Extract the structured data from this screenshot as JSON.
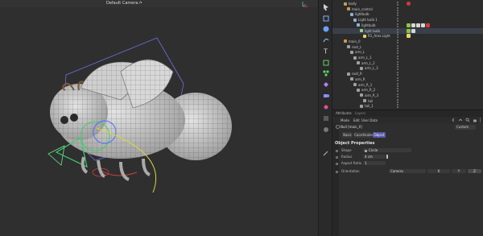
{
  "viewport": {
    "camera_label": "Default Camera ⁄•"
  },
  "object_manager": {
    "rows": [
      {
        "label": "body",
        "indent": 14,
        "color": "#b9a35a"
      },
      {
        "label": "main_control",
        "indent": 18,
        "color": "#c89b4c"
      },
      {
        "label": "lightbulb",
        "indent": 22,
        "color": "#8fb0d6"
      },
      {
        "label": "Light bulb 1",
        "indent": 26,
        "color": "#8fb0d6"
      },
      {
        "label": "lightbulb",
        "indent": 30,
        "color": "#8fb0d6"
      },
      {
        "label": "light bulb",
        "indent": 34,
        "color": "#9fd08f"
      },
      {
        "label": "R1_Area Light",
        "indent": 38,
        "color": "#e6d760"
      },
      {
        "label": "main_0",
        "indent": 14,
        "color": "#c89b4c"
      },
      {
        "label": "root_L",
        "indent": 18,
        "color": "#a0a0a0"
      },
      {
        "label": "arm_L",
        "indent": 22,
        "color": "#a0a0a0"
      },
      {
        "label": "arm_L_1",
        "indent": 26,
        "color": "#a0a0a0"
      },
      {
        "label": "arm_L_2",
        "indent": 30,
        "color": "#a0a0a0"
      },
      {
        "label": "arm_L_3",
        "indent": 34,
        "color": "#a0a0a0"
      },
      {
        "label": "root_R",
        "indent": 18,
        "color": "#a0a0a0"
      },
      {
        "label": "arm_R",
        "indent": 22,
        "color": "#a0a0a0"
      },
      {
        "label": "arm_R_1",
        "indent": 26,
        "color": "#a0a0a0"
      },
      {
        "label": "arm_R_2",
        "indent": 30,
        "color": "#a0a0a0"
      },
      {
        "label": "arm_R_3",
        "indent": 34,
        "color": "#a0a0a0"
      },
      {
        "label": "tail",
        "indent": 38,
        "color": "#a0a0a0"
      },
      {
        "label": "tail_1",
        "indent": 34,
        "color": "#a0a0a0"
      }
    ]
  },
  "attributes": {
    "tabs": [
      "Attributes",
      "Layers"
    ],
    "menu": [
      "Mode",
      "Edit",
      "User Data"
    ],
    "object_name": "Null [main_0]",
    "mode_select": "Custom",
    "sub_tabs": [
      "Basic",
      "Coordinates",
      "Object"
    ],
    "active_sub_tab": "Object",
    "section_title": "Object Properties",
    "props": [
      {
        "label": "Shape",
        "value": "Circle"
      },
      {
        "label": "Radius",
        "value": "4 cm"
      },
      {
        "label": "Aspect Ratio",
        "value": "1"
      },
      {
        "label": "Orientation",
        "value": "Camera"
      }
    ],
    "orientation_options": [
      "X",
      "Y",
      "Z"
    ]
  },
  "colors": {
    "accent": "#5757a8",
    "selection": "#3a3f4a"
  }
}
